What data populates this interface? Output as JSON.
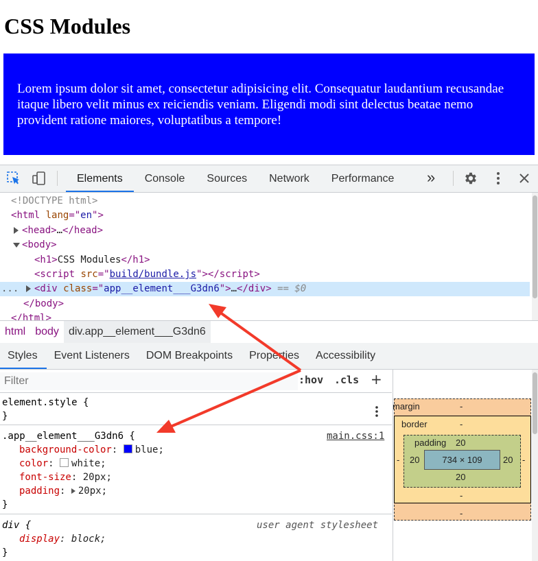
{
  "page": {
    "title": "CSS Modules",
    "paragraph": "Lorem ipsum dolor sit amet, consectetur adipisicing elit. Consequatur laudantium recusandae itaque libero velit minus ex reiciendis veniam. Eligendi modi sint delectus beatae nemo provident ratione maiores, voluptatibus a tempore!"
  },
  "devtools": {
    "tabs": [
      "Elements",
      "Console",
      "Sources",
      "Network",
      "Performance"
    ],
    "more_tabs": "»",
    "dom": {
      "doctype": "<!DOCTYPE html>",
      "html_open": {
        "tag": "html",
        "attr": "lang",
        "value": "en"
      },
      "head": "head",
      "head_ellipsis": "…",
      "body": "body",
      "h1_text": "CSS Modules",
      "script_src": "build/bundle.js",
      "div_class": "app__element___G3dn6",
      "div_ellipsis": "…",
      "selected_marker": "== $0",
      "dots": "..."
    },
    "breadcrumbs": [
      "html",
      "body",
      "div.app__element___G3dn6"
    ],
    "subtabs": [
      "Styles",
      "Event Listeners",
      "DOM Breakpoints",
      "Properties",
      "Accessibility"
    ],
    "styles": {
      "filter_placeholder": "Filter",
      "hov": ":hov",
      "cls": ".cls",
      "plus": "+",
      "element_style": "element.style {",
      "close_brace": "}",
      "rule_selector": ".app__element___G3dn6 {",
      "rule_source": "main.css:1",
      "props": [
        {
          "name": "background-color",
          "value": "blue",
          "swatch": "#0000ff"
        },
        {
          "name": "color",
          "value": "white",
          "swatch": "#ffffff"
        },
        {
          "name": "font-size",
          "value": "20px"
        },
        {
          "name": "padding",
          "value": "20px"
        }
      ],
      "ua_selector": "div {",
      "ua_source": "user agent stylesheet",
      "ua_prop": {
        "name": "display",
        "value": "block"
      }
    },
    "box_model": {
      "margin_label": "margin",
      "margin_value": "-",
      "border_label": "border",
      "border_value": "-",
      "padding_label": "padding",
      "padding_top": "20",
      "padding_left": "20",
      "padding_right": "20",
      "padding_bottom": "20",
      "content": "734 × 109",
      "border_bottom": "-",
      "margin_bottom": "-",
      "side_left": "-",
      "side_right": "-"
    }
  },
  "colors": {
    "box_blue": "#0000ff",
    "accent": "#1a73e8",
    "annotation_arrow": "#f23a2a"
  }
}
